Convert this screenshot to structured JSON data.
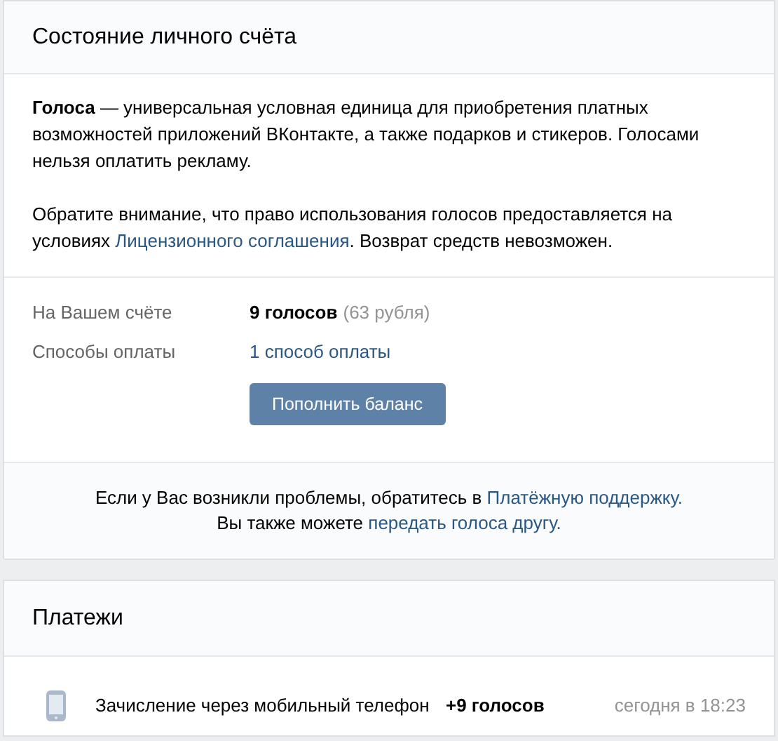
{
  "balance_card": {
    "title": "Состояние личного счёта",
    "paragraphs": [
      {
        "parts": [
          {
            "kind": "text",
            "text": "**Голоса** — универсальная условная единица для приобретения платных возможностей приложений ВКонтакте, а также подарков и стикеров. Голосами нельзя оплатить рекламу."
          }
        ]
      },
      {
        "parts": [
          {
            "kind": "text",
            "text": "Обратите внимание, что право использования голосов предоставляется на условиях "
          },
          {
            "kind": "link",
            "text": "Лицензионного соглашения"
          },
          {
            "kind": "text",
            "text": ". Возврат средств невозможен."
          }
        ]
      }
    ],
    "rows": [
      {
        "label": "На Вашем счёте",
        "kind": "amount",
        "value": "9 голосов",
        "note": "(63 рубля)"
      },
      {
        "label": "Способы оплаты",
        "kind": "link",
        "value": "1 способ оплаты"
      }
    ],
    "button": "Пополнить баланс",
    "footer": [
      [
        {
          "kind": "text",
          "text": "Если у Вас возникли проблемы, обратитесь в "
        },
        {
          "kind": "link",
          "text": "Платёжную поддержку."
        }
      ],
      [
        {
          "kind": "text",
          "text": "Вы также можете "
        },
        {
          "kind": "link",
          "text": "передать голоса другу."
        }
      ]
    ]
  },
  "payments_card": {
    "title": "Платежи",
    "rows": [
      {
        "description": "Зачисление через мобильный телефон",
        "amount": "+9 голосов",
        "time": "сегодня в 18:23"
      }
    ]
  }
}
